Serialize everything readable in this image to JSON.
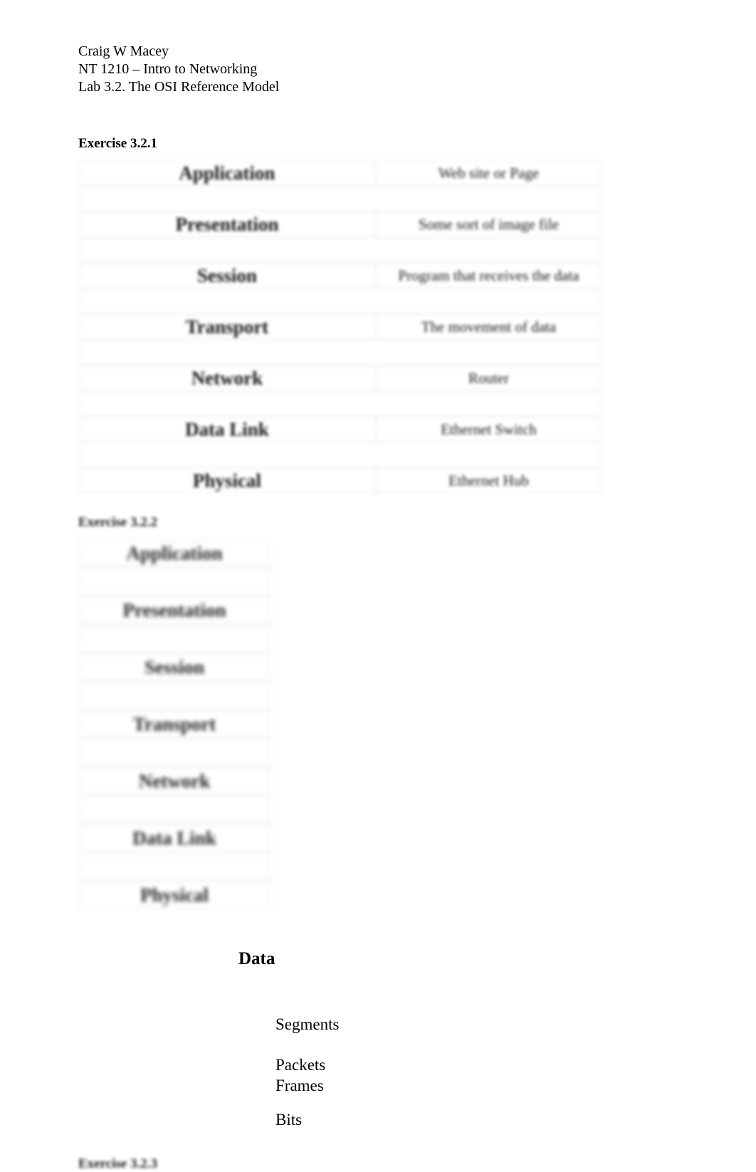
{
  "header": {
    "name": "Craig W Macey",
    "course": "NT 1210 – Intro to Networking",
    "lab": "Lab 3.2. The OSI Reference Model"
  },
  "exercise1": {
    "title": "Exercise 3.2.1",
    "rows": [
      {
        "layer": "Application",
        "example": "Web site or Page"
      },
      {
        "layer": "Presentation",
        "example": "Some sort of image file"
      },
      {
        "layer": "Session",
        "example": "Program that receives the data"
      },
      {
        "layer": "Transport",
        "example": "The movement of data"
      },
      {
        "layer": "Network",
        "example": "Router"
      },
      {
        "layer": "Data Link",
        "example": "Ethernet Switch"
      },
      {
        "layer": "Physical",
        "example": "Ethernet Hub"
      }
    ]
  },
  "exercise2": {
    "title": "Exercise 3.2.2",
    "layers": [
      "Application",
      "Presentation",
      "Session",
      "Transport",
      "Network",
      "Data Link",
      "Physical"
    ],
    "pdu_header": "Data",
    "pdus": [
      "Segments",
      "Packets",
      "Frames",
      "Bits"
    ]
  },
  "exercise3": {
    "title": "Exercise 3.2.3"
  }
}
